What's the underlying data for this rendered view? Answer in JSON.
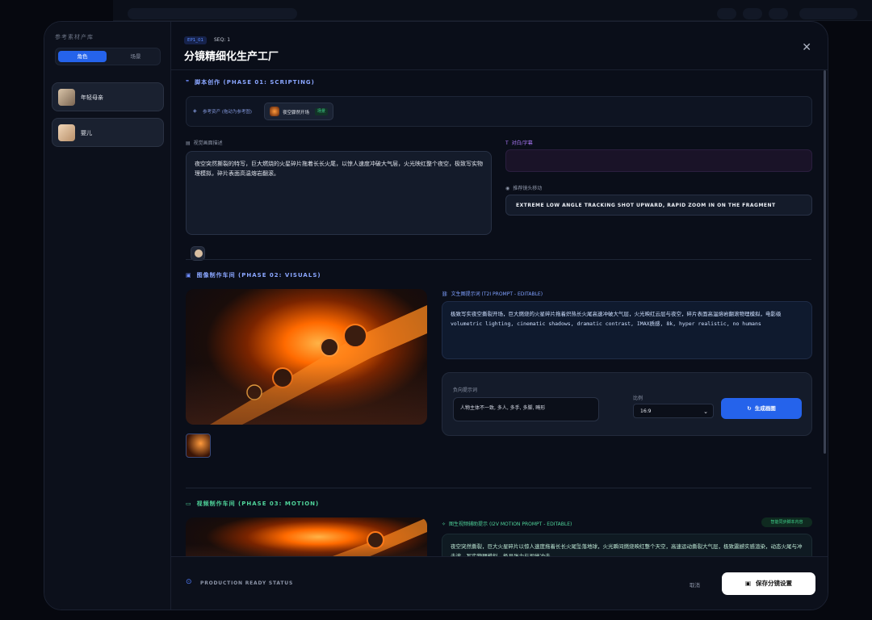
{
  "sidebar": {
    "title": "参考素材产库",
    "tab_active": "角色",
    "tab_inactive": "场景",
    "assets": [
      {
        "name": "年轻母亲"
      },
      {
        "name": "婴儿"
      }
    ]
  },
  "header": {
    "episode_tag": "EP1_01",
    "seq": "SEQ: 1",
    "title": "分镜精细化生产工厂"
  },
  "phase1": {
    "title": "脚本创作 (PHASE 01: SCRIPTING)",
    "ref_label": "参考资产 (拖动为参考图)",
    "ref_item": "夜空骤然开场",
    "ref_badge": "场景",
    "visual_label": "视觉画面描述",
    "visual_text": "夜空突然撕裂的特写，巨大燃烧的火星碎片拖着长长火尾，以惊人速度冲破大气层，火光映红整个夜空，极致写实物理模拟，碎片表面高温熔岩翻滚。",
    "dialog_label": "对白/字幕",
    "camera_label": "推荐镜头移动",
    "camera_text": "EXTREME LOW ANGLE TRACKING SHOT UPWARD, RAPID ZOOM IN ON THE FRAGMENT"
  },
  "phase2": {
    "title": "图像制作车间 (PHASE 02: VISUALS)",
    "prompt_label": "文生图提示词 (T2I PROMPT - EDITABLE)",
    "prompt_text": "极致写实夜空撕裂开场，巨大燃烧的火星碎片拖着炽热长火尾高速冲破大气层，火光映红云层与夜空，碎片表面高温熔岩翻滚物理模拟，电影级 volumetric lighting, cinematic shadows, dramatic contrast, IMAX质感, 8k, hyper realistic, no humans",
    "neg_label": "负向提示词",
    "neg_text": "人物主体不一致, 多人, 多手, 多脚, 畸形",
    "ratio_label": "比例",
    "ratio_value": "16:9",
    "generate_label": "生成画图"
  },
  "phase3": {
    "title": "视频制作车间 (PHASE 03: MOTION)",
    "prompt_label": "图生视频辅助提示 (I2V MOTION PROMPT - EDITABLE)",
    "sync_label": "智能同步脚本内容",
    "prompt_text": "夜空突然撕裂，巨大火星碎片以惊人速度拖着长长火尾坠落地球，火光瞬间燃烧映红整个天空，高速运动撕裂大气层，极致震撼实感渲染，动态火尾与冲击波，写实物理模拟，极具张力与视觉冲击。"
  },
  "footer": {
    "status": "PRODUCTION READY STATUS",
    "cancel": "取消",
    "save": "保存分镜设置"
  }
}
